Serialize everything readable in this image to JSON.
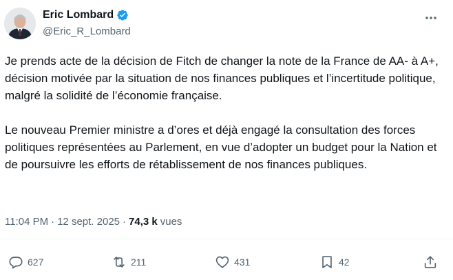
{
  "author": {
    "display_name": "Eric Lombard",
    "handle": "@Eric_R_Lombard",
    "verified": true
  },
  "tweet": {
    "paragraphs": [
      "Je prends acte de la décision de Fitch de changer la note de la France de AA- à A+, décision motivée par la situation de nos finances publiques et l’incertitude politique, malgré la solidité de l’économie française.",
      "Le nouveau Premier ministre a d’ores et déjà engagé la consultation des forces politiques représentées au Parlement, en vue d’adopter un budget pour la Nation et de poursuivre les efforts de rétablissement de nos finances publiques."
    ],
    "time": "11:04 PM",
    "separator": "·",
    "date": "12 sept. 2025",
    "views_count": "74,3 k",
    "views_label": "vues"
  },
  "actions": {
    "replies": "627",
    "reposts": "211",
    "likes": "431",
    "bookmarks": "42"
  },
  "colors": {
    "text_primary": "#0f1419",
    "text_secondary": "#536471",
    "verified": "#1d9bf0"
  },
  "icons": {
    "more": "ellipsis-icon",
    "reply": "reply-icon",
    "repost": "repost-icon",
    "like": "heart-icon",
    "bookmark": "bookmark-icon",
    "share": "share-icon",
    "verified": "verified-badge-icon"
  }
}
